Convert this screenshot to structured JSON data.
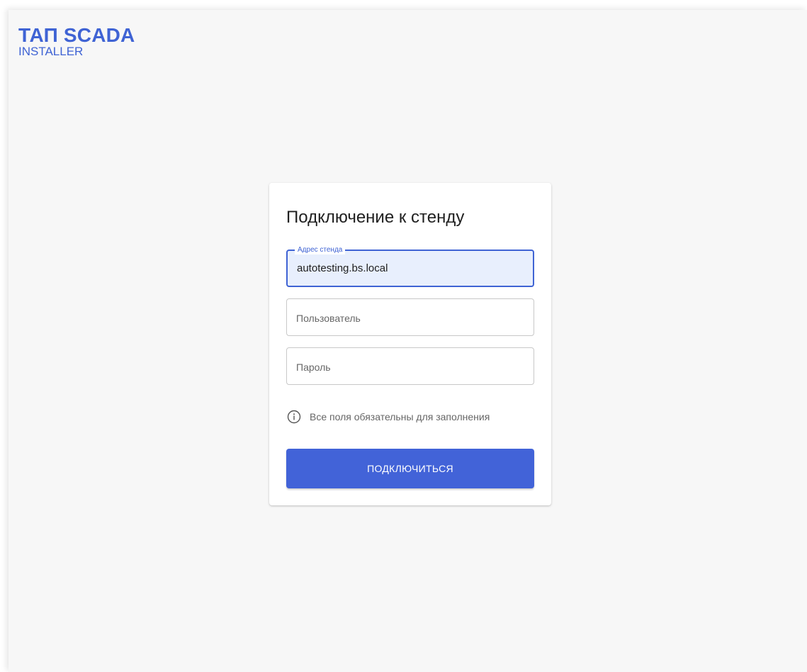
{
  "logo": {
    "title": "ТАП SCADA",
    "subtitle": "INSTALLER"
  },
  "form": {
    "title": "Подключение к стенду",
    "address": {
      "label": "Адрес стенда",
      "value": "autotesting.bs.local"
    },
    "user": {
      "placeholder": "Пользователь",
      "value": ""
    },
    "password": {
      "placeholder": "Пароль",
      "value": ""
    },
    "hint": "Все поля обязательны для заполнения",
    "hint_icon": "info-circle-icon",
    "submit_label": "ПОДКЛЮЧИТЬСЯ"
  },
  "colors": {
    "accent": "#4263d8",
    "background": "#f7f7f7",
    "focused_field": "#e8effd"
  }
}
